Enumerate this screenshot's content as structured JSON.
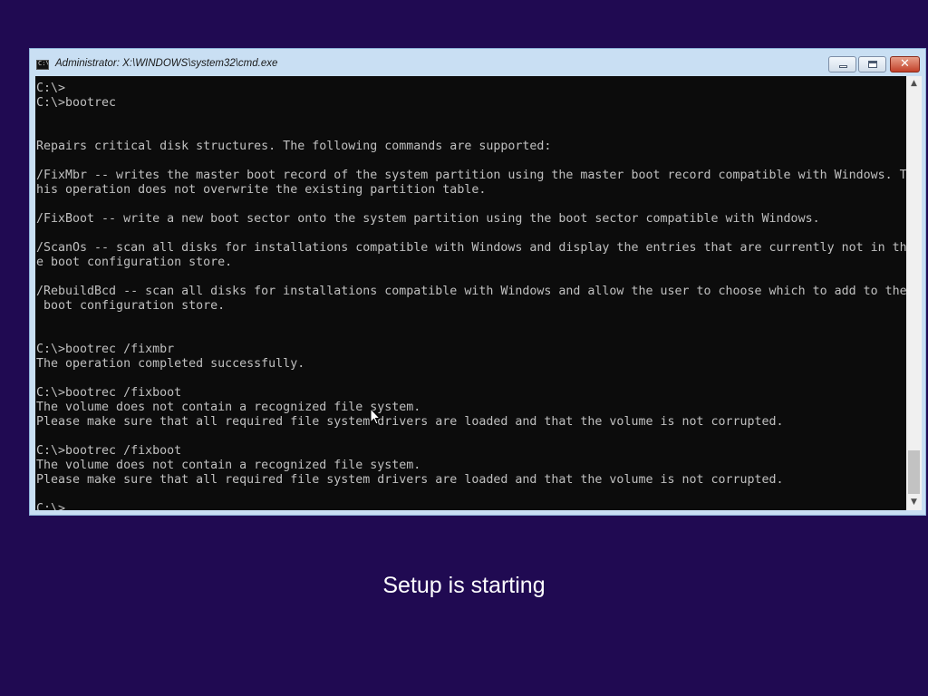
{
  "window": {
    "title": "Administrator: X:\\WINDOWS\\system32\\cmd.exe",
    "icon": "cmd-icon",
    "controls": {
      "minimize_icon": "minimize-icon",
      "maximize_icon": "maximize-icon",
      "close_icon": "close-icon",
      "close_glyph": "✕"
    }
  },
  "console": {
    "lines": [
      "C:\\>",
      "C:\\>bootrec",
      "",
      "",
      "Repairs critical disk structures. The following commands are supported:",
      "",
      "/FixMbr -- writes the master boot record of the system partition using the master boot record compatible with Windows. T",
      "his operation does not overwrite the existing partition table.",
      "",
      "/FixBoot -- write a new boot sector onto the system partition using the boot sector compatible with Windows.",
      "",
      "/ScanOs -- scan all disks for installations compatible with Windows and display the entries that are currently not in th",
      "e boot configuration store.",
      "",
      "/RebuildBcd -- scan all disks for installations compatible with Windows and allow the user to choose which to add to the",
      " boot configuration store.",
      "",
      "",
      "C:\\>bootrec /fixmbr",
      "The operation completed successfully.",
      "",
      "C:\\>bootrec /fixboot",
      "The volume does not contain a recognized file system.",
      "Please make sure that all required file system drivers are loaded and that the volume is not corrupted.",
      "",
      "C:\\>bootrec /fixboot",
      "The volume does not contain a recognized file system.",
      "Please make sure that all required file system drivers are loaded and that the volume is not corrupted.",
      "",
      "C:\\>"
    ]
  },
  "scrollbar": {
    "up_arrow": "▲",
    "down_arrow": "▼"
  },
  "setup": {
    "status": "Setup is starting"
  }
}
